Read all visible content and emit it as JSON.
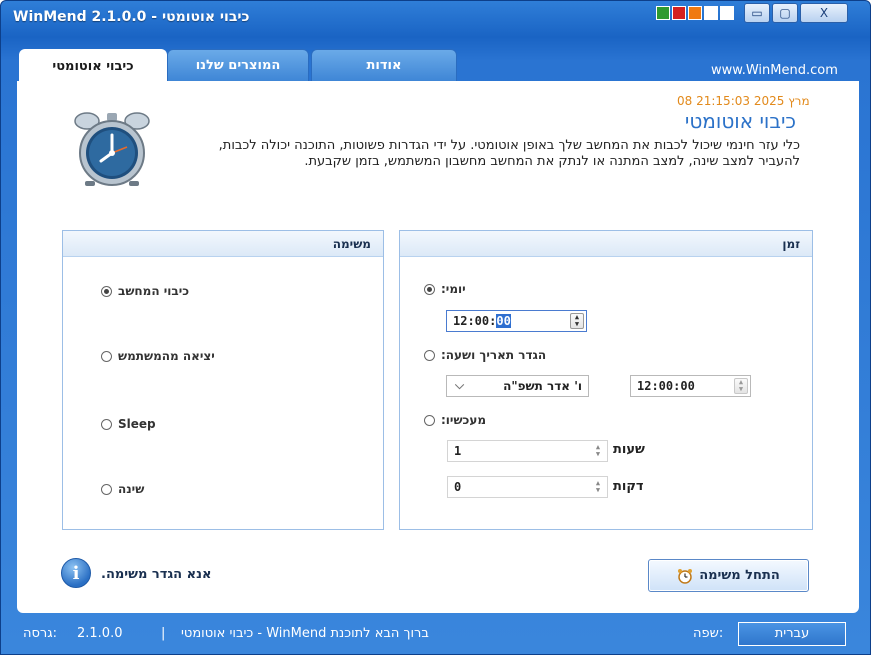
{
  "window": {
    "title": "כיבוי אוטומטי - WinMend 2.1.0.0",
    "skin_colors": [
      "#2f9a2f",
      "#d42020",
      "#f07a10",
      "#ffffff",
      "#ffffff"
    ],
    "minimize_glyph": "▭",
    "maximize_glyph": "▢",
    "close_glyph": "X"
  },
  "tabs": [
    {
      "label": "כיבוי אוטומטי",
      "active": true
    },
    {
      "label": "המוצרים שלנו",
      "active": false
    },
    {
      "label": "אודות",
      "active": false
    }
  ],
  "site_link": "www.WinMend.com",
  "datetime_display": "מרץ 2025 21:15:03 08",
  "header": {
    "title": "כיבוי אוטומטי",
    "description": "כלי עזר חינמי שיכול לכבות את המחשב שלך באופן אוטומטי. על ידי הגדרות פשוטות, התוכנה יכולה לכבות, להעביר למצב שינה, למצב המתנה או לנתק את המחשב מחשבון המשתמש, בזמן שקבעת."
  },
  "task_group": {
    "title": "משימה",
    "options": [
      {
        "label": "כיבוי המחשב",
        "checked": true
      },
      {
        "label": "יציאה מהמשתמש",
        "checked": false
      },
      {
        "label": "Sleep",
        "checked": false
      },
      {
        "label": "שינה",
        "checked": false
      }
    ]
  },
  "time_group": {
    "title": "זמן",
    "daily_label": "יומי:",
    "daily_time_prefix": "12:00:",
    "daily_time_selected": "00",
    "set_date_label": "הגדר תאריך ושעה:",
    "date_value": "ו' אדר  תשפ\"ה",
    "time_value": "12:00:00",
    "from_now_label": "מעכשיו:",
    "hours_value": "1",
    "hours_unit": "שעות",
    "minutes_value": "0",
    "minutes_unit": "דקות"
  },
  "actions": {
    "info_text": "אנא הגדר משימה.",
    "start_label": "התחל משימה"
  },
  "status_bar": {
    "version_label": "גרסה:",
    "version_value": "2.1.0.0",
    "separator": "|",
    "welcome": "ברוך הבא לתוכנת WinMend - כיבוי אוטומטי",
    "language_label": "שפה:",
    "language_value": "עברית"
  }
}
